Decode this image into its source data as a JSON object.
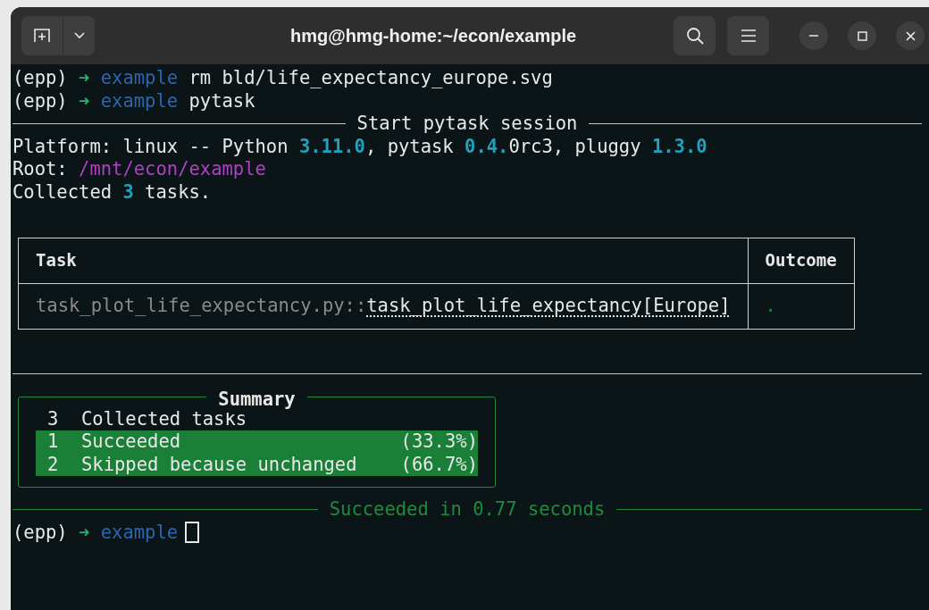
{
  "window": {
    "title": "hmg@hmg-home:~/econ/example"
  },
  "terminal": [
    {
      "kind": "text",
      "segments": [
        {
          "text": "(epp) ",
          "kind": "plain"
        },
        {
          "text": "➜ ",
          "kind": "arrow"
        },
        {
          "text": "example",
          "kind": "dir"
        },
        {
          "text": " rm bld/life_expectancy_europe.svg",
          "kind": "plain"
        }
      ]
    },
    {
      "kind": "text",
      "segments": [
        {
          "text": "(epp) ",
          "kind": "plain"
        },
        {
          "text": "➜ ",
          "kind": "arrow"
        },
        {
          "text": "example",
          "kind": "dir"
        },
        {
          "text": " pytask",
          "kind": "plain"
        }
      ]
    },
    {
      "kind": "rule",
      "title": "Start pytask session",
      "success": false
    },
    {
      "kind": "text",
      "segments": [
        {
          "text": "Platform: linux -- Python ",
          "kind": "plain"
        },
        {
          "text": "3.11.0",
          "kind": "number"
        },
        {
          "text": ", pytask ",
          "kind": "plain"
        },
        {
          "text": "0.4.",
          "kind": "number"
        },
        {
          "text": "0rc3, pluggy ",
          "kind": "plain"
        },
        {
          "text": "1.3.0",
          "kind": "number"
        }
      ]
    },
    {
      "kind": "text",
      "segments": [
        {
          "text": "Root: ",
          "kind": "plain"
        },
        {
          "text": "/mnt/econ/example",
          "kind": "path"
        }
      ]
    },
    {
      "kind": "text",
      "segments": [
        {
          "text": "Collected ",
          "kind": "plain"
        },
        {
          "text": "3",
          "kind": "number"
        },
        {
          "text": " tasks.",
          "kind": "plain"
        }
      ]
    },
    {
      "kind": "blank"
    },
    {
      "kind": "table",
      "columns": [
        "Task",
        "Outcome"
      ],
      "rows": [
        {
          "module": "task_plot_life_expectancy.py::",
          "task": "task_plot_life_expectancy[Europe]",
          "outcome": "."
        }
      ]
    },
    {
      "kind": "blank"
    },
    {
      "kind": "rule",
      "success": false
    },
    {
      "kind": "summary",
      "title": "Summary",
      "rows": [
        {
          "count": "3",
          "label": "Collected tasks",
          "highlighted": false
        },
        {
          "count": "1",
          "label": "Succeeded",
          "percent": "(33.3%)",
          "highlighted": true
        },
        {
          "count": "2",
          "label": "Skipped because unchanged",
          "percent": "(66.7%)",
          "highlighted": true
        }
      ]
    },
    {
      "kind": "rule",
      "title": "Succeeded in 0.77 seconds",
      "success": true
    },
    {
      "kind": "text",
      "cursor": true,
      "segments": [
        {
          "text": "(epp) ",
          "kind": "plain"
        },
        {
          "text": "➜ ",
          "kind": "arrow"
        },
        {
          "text": "example",
          "kind": "dir"
        }
      ]
    }
  ]
}
